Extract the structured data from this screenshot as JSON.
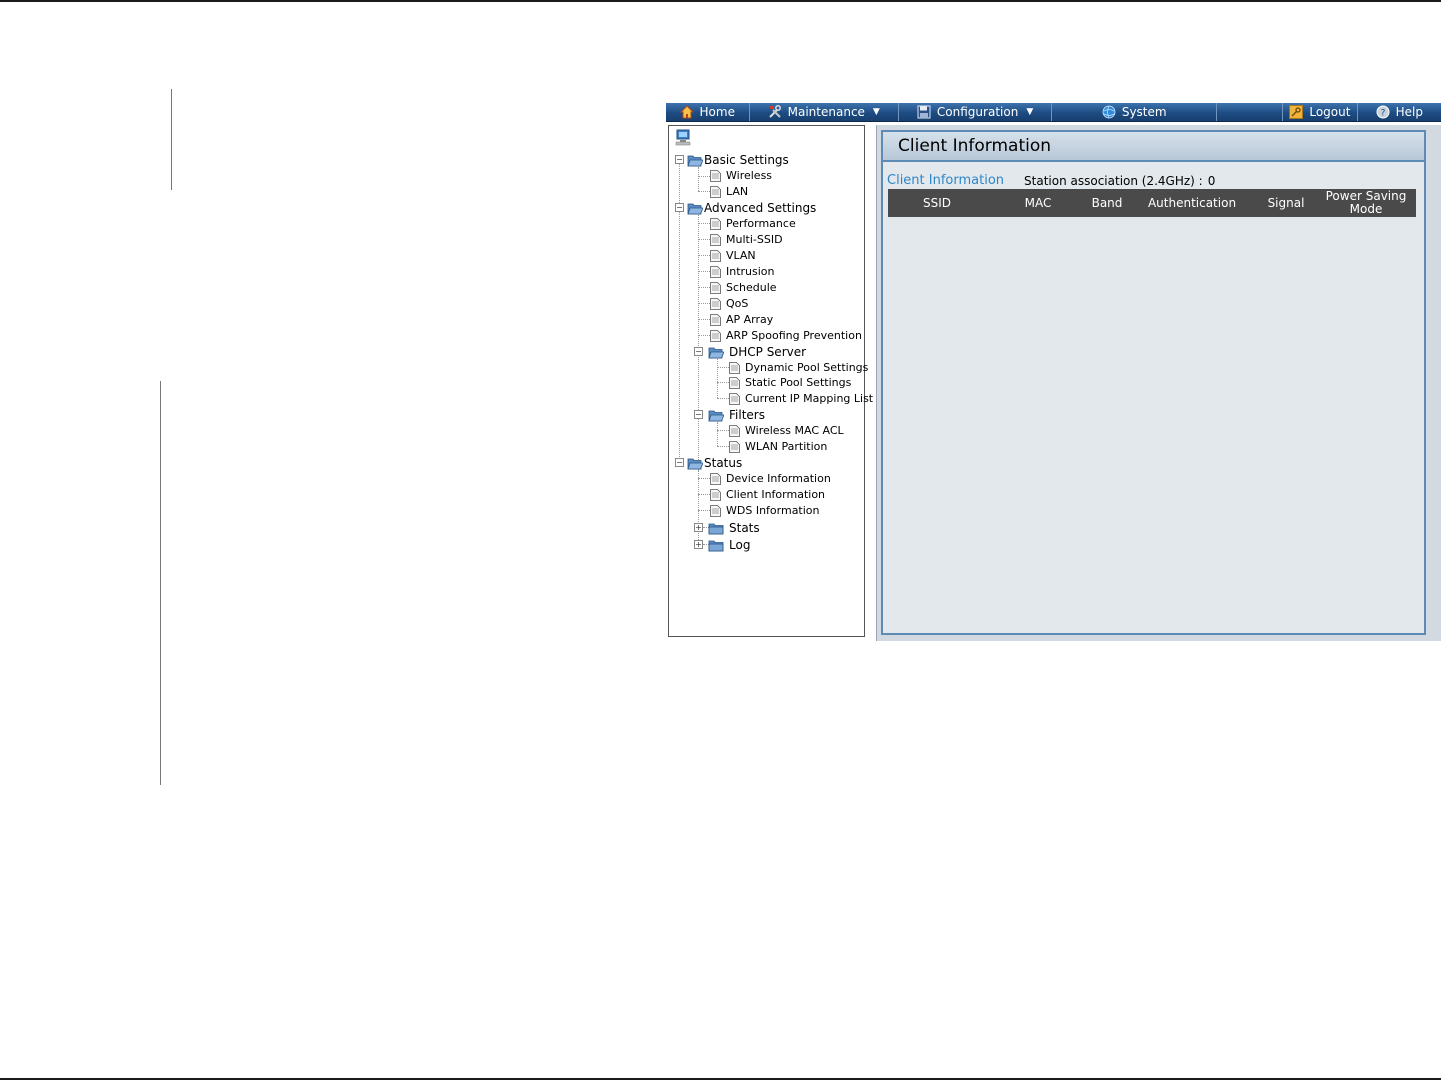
{
  "menubar": {
    "items": [
      {
        "label": "Home",
        "icon": "home-icon",
        "dropdown": false
      },
      {
        "label": "Maintenance",
        "icon": "tools-icon",
        "dropdown": true
      },
      {
        "label": "Configuration",
        "icon": "floppy-icon",
        "dropdown": true
      },
      {
        "label": "System",
        "icon": "globe-icon",
        "dropdown": false
      },
      {
        "label": "Logout",
        "icon": "key-icon",
        "dropdown": false
      },
      {
        "label": "Help",
        "icon": "help-icon",
        "dropdown": false
      }
    ]
  },
  "tree": {
    "root_icon": "network-computer-icon",
    "basic_settings": {
      "label": "Basic Settings",
      "items": [
        "Wireless",
        "LAN"
      ]
    },
    "advanced_settings": {
      "label": "Advanced Settings",
      "items": [
        "Performance",
        "Multi-SSID",
        "VLAN",
        "Intrusion",
        "Schedule",
        "QoS",
        "AP Array",
        "ARP Spoofing Prevention"
      ],
      "dhcp_server": {
        "label": "DHCP Server",
        "items": [
          "Dynamic Pool Settings",
          "Static Pool Settings",
          "Current IP Mapping List"
        ]
      },
      "filters": {
        "label": "Filters",
        "items": [
          "Wireless MAC ACL",
          "WLAN Partition"
        ]
      }
    },
    "status": {
      "label": "Status",
      "items": [
        "Device Information",
        "Client Information",
        "WDS Information"
      ],
      "stats": {
        "label": "Stats"
      },
      "log": {
        "label": "Log"
      }
    }
  },
  "content": {
    "title": "Client Information",
    "section_label": "Client Information",
    "station_association_label": "Station association (2.4GHz) :",
    "station_association_count": "0",
    "table": {
      "columns": [
        "SSID",
        "MAC",
        "Band",
        "Authentication",
        "Signal",
        "Power Saving Mode"
      ],
      "rows": []
    }
  },
  "colors": {
    "menubar": "#1d4c83",
    "section_label": "#2e86c8",
    "table_header": "#4a4a4a",
    "panel_border": "#5e8bb5"
  }
}
